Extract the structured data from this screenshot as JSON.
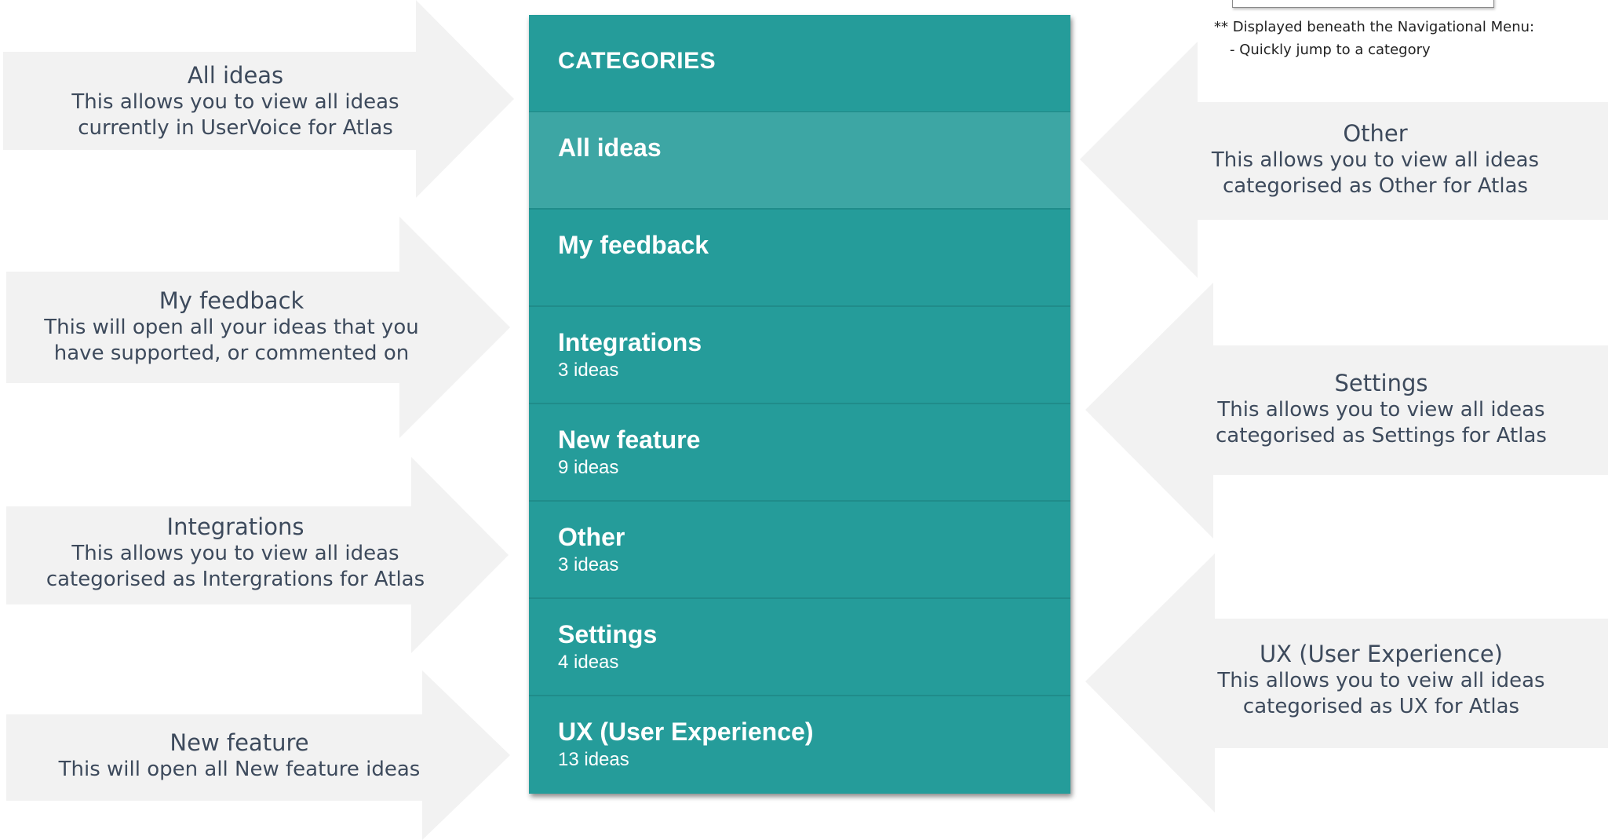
{
  "panel": {
    "header": "CATEGORIES",
    "items": [
      {
        "name": "All ideas",
        "count": "",
        "active": true
      },
      {
        "name": "My feedback",
        "count": ""
      },
      {
        "name": "Integrations",
        "count": "3 ideas"
      },
      {
        "name": "New feature",
        "count": "9 ideas"
      },
      {
        "name": "Other",
        "count": "3 ideas"
      },
      {
        "name": "Settings",
        "count": "4 ideas"
      },
      {
        "name": "UX (User Experience)",
        "count": "13 ideas"
      }
    ]
  },
  "callouts": {
    "all_ideas": {
      "title": "All ideas",
      "desc": "This allows you to view all ideas\ncurrently in UserVoice for Atlas"
    },
    "my_feedback": {
      "title": "My feedback",
      "desc": "This will open all your ideas that you\nhave supported, or commented on"
    },
    "integrations": {
      "title": "Integrations",
      "desc": "This allows you to view all ideas\ncategorised as Intergrations for Atlas"
    },
    "new_feature": {
      "title": "New feature",
      "desc": "This will open all New feature ideas"
    },
    "other": {
      "title": "Other",
      "desc": "This allows you to view all ideas\ncategorised as Other for Atlas"
    },
    "settings": {
      "title": "Settings",
      "desc": "This allows you to view all ideas\ncategorised as Settings for Atlas"
    },
    "ux": {
      "title": "UX (User Experience)",
      "desc": "This allows you to veiw all ideas\ncategorised as UX for Atlas"
    }
  },
  "note": {
    "line1": "** Displayed beneath the Navigational Menu:",
    "line2": "- Quickly jump to a category"
  },
  "colors": {
    "panel": "#259c9a",
    "active_row": "#3da6a4",
    "callout_fill": "#f2f2f2",
    "callout_text": "#3d4a5c"
  }
}
